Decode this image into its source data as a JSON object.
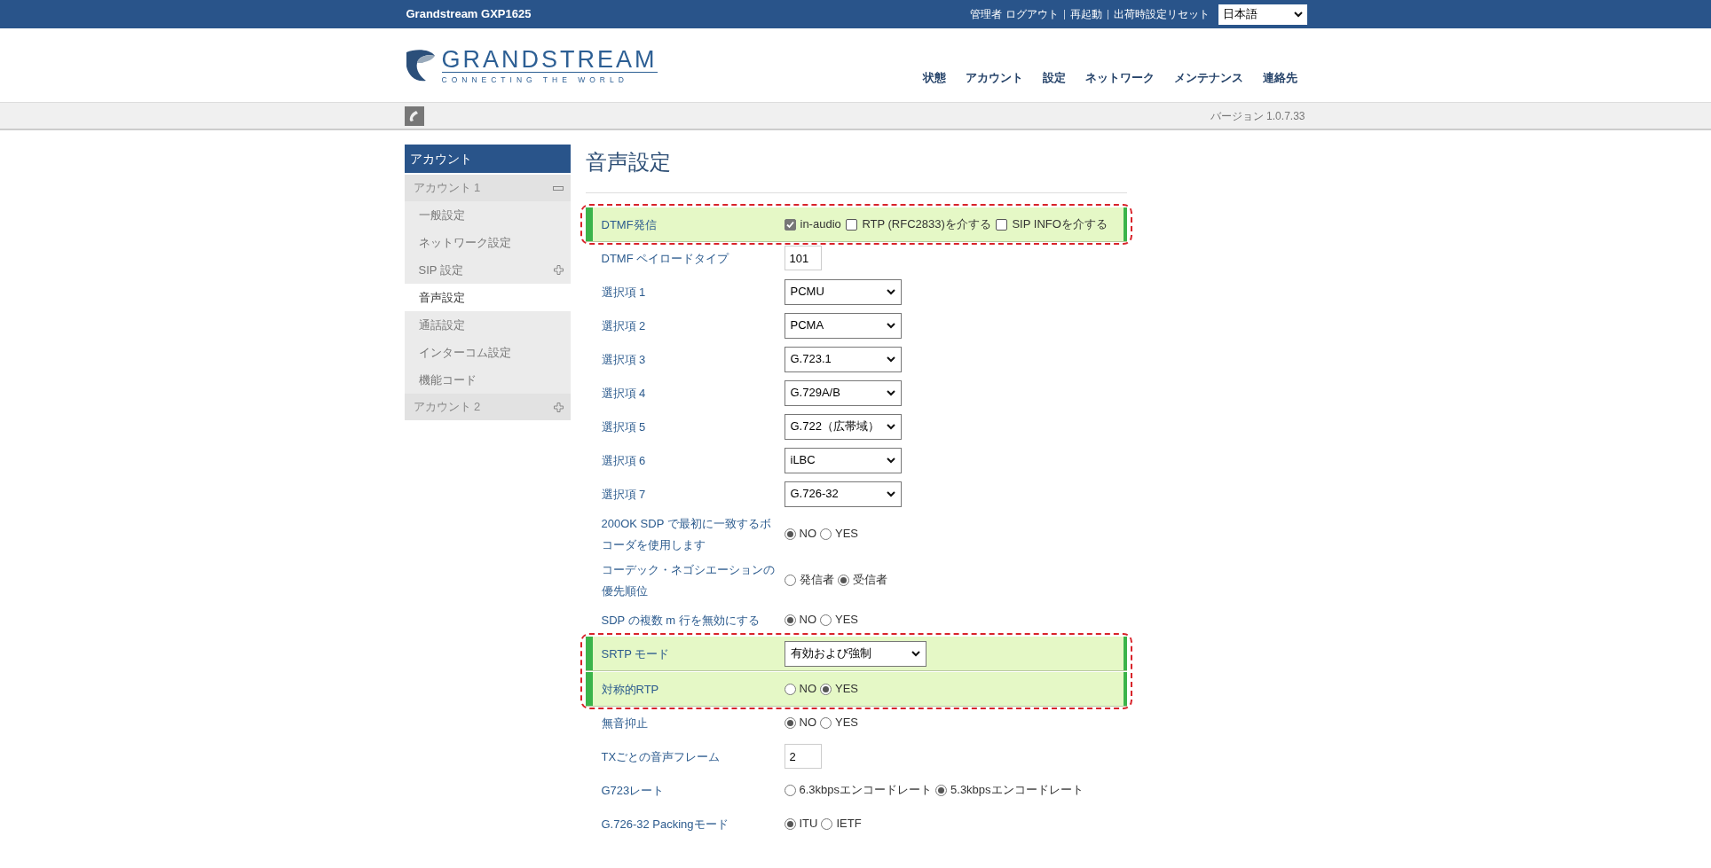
{
  "top_bar": {
    "product": "Grandstream GXP1625",
    "links": [
      "管理者",
      "ログアウト",
      "再起動",
      "出荷時設定リセット"
    ],
    "language": "日本語"
  },
  "logo": {
    "name": "GRANDSTREAM",
    "tagline": "CONNECTING THE WORLD"
  },
  "nav": [
    {
      "label": "状態",
      "selected": false
    },
    {
      "label": "アカウント",
      "selected": false
    },
    {
      "label": "設定",
      "selected": false
    },
    {
      "label": "ネットワーク",
      "selected": false
    },
    {
      "label": "メンテナンス",
      "selected": false
    },
    {
      "label": "連絡先",
      "selected": false
    }
  ],
  "version": "バージョン 1.0.7.33",
  "sidebar": {
    "title": "アカウント",
    "groups": [
      {
        "label": "アカウント 1",
        "expanded": true,
        "children": [
          {
            "label": "一般設定",
            "selected": false
          },
          {
            "label": "ネットワーク設定",
            "selected": false
          },
          {
            "label": "SIP 設定",
            "selected": false,
            "expanded": false
          },
          {
            "label": "音声設定",
            "selected": true
          },
          {
            "label": "通話設定",
            "selected": false
          },
          {
            "label": "インターコム設定",
            "selected": false
          },
          {
            "label": "機能コード",
            "selected": false
          }
        ]
      },
      {
        "label": "アカウント 2",
        "expanded": false
      }
    ]
  },
  "page_title": "音声設定",
  "rows": [
    {
      "kind": "checkboxes",
      "label": "DTMF発信",
      "highlighted": true,
      "options": [
        {
          "label": "in-audio",
          "checked": true
        },
        {
          "label": "RTP (RFC2833)を介する",
          "checked": false
        },
        {
          "label": "SIP INFOを介する",
          "checked": false
        }
      ]
    },
    {
      "kind": "text",
      "label": "DTMF ペイロードタイプ",
      "highlighted": false,
      "value": "101"
    },
    {
      "kind": "select",
      "label": "選択項 1",
      "highlighted": false,
      "value": "PCMU"
    },
    {
      "kind": "select",
      "label": "選択項 2",
      "highlighted": false,
      "value": "PCMA"
    },
    {
      "kind": "select",
      "label": "選択項 3",
      "highlighted": false,
      "value": "G.723.1"
    },
    {
      "kind": "select",
      "label": "選択項 4",
      "highlighted": false,
      "value": "G.729A/B"
    },
    {
      "kind": "select",
      "label": "選択項 5",
      "highlighted": false,
      "value": "G.722（広帯域）"
    },
    {
      "kind": "select",
      "label": "選択項 6",
      "highlighted": false,
      "value": "iLBC"
    },
    {
      "kind": "select",
      "label": "選択項 7",
      "highlighted": false,
      "value": "G.726-32"
    },
    {
      "kind": "radios",
      "label": "200OK SDP で最初に一致するボコーダを使用します",
      "highlighted": false,
      "options": [
        {
          "label": "NO",
          "selected": true
        },
        {
          "label": "YES",
          "selected": false
        }
      ]
    },
    {
      "kind": "radios",
      "label": "コーデック・ネゴシエーションの優先順位",
      "highlighted": false,
      "options": [
        {
          "label": "発信者",
          "selected": false
        },
        {
          "label": "受信者",
          "selected": true
        }
      ]
    },
    {
      "kind": "radios",
      "label": "SDP の複数 m 行を無効にする",
      "highlighted": false,
      "options": [
        {
          "label": "NO",
          "selected": true
        },
        {
          "label": "YES",
          "selected": false
        }
      ]
    },
    {
      "kind": "wide_select",
      "label": "SRTP モード",
      "highlighted": true,
      "value": "有効および強制"
    },
    {
      "kind": "radios",
      "label": "対称的RTP",
      "highlighted": true,
      "options": [
        {
          "label": "NO",
          "selected": false
        },
        {
          "label": "YES",
          "selected": true
        }
      ]
    },
    {
      "kind": "radios",
      "label": "無音抑止",
      "highlighted": false,
      "options": [
        {
          "label": "NO",
          "selected": true
        },
        {
          "label": "YES",
          "selected": false
        }
      ]
    },
    {
      "kind": "text",
      "label": "TXごとの音声フレーム",
      "highlighted": false,
      "value": "2"
    },
    {
      "kind": "radios",
      "label": "G723レート",
      "highlighted": false,
      "options": [
        {
          "label": "6.3kbpsエンコードレート",
          "selected": false
        },
        {
          "label": "5.3kbpsエンコードレート",
          "selected": true
        }
      ]
    },
    {
      "kind": "radios",
      "label": "G.726-32 Packingモード",
      "highlighted": false,
      "options": [
        {
          "label": "ITU",
          "selected": true
        },
        {
          "label": "IETF",
          "selected": false
        }
      ]
    }
  ]
}
